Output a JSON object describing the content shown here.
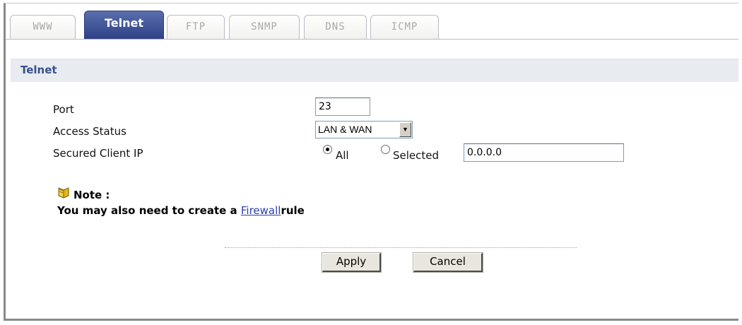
{
  "tabs": [
    {
      "label": "WWW",
      "active": false
    },
    {
      "label": "Telnet",
      "active": true
    },
    {
      "label": "FTP",
      "active": false
    },
    {
      "label": "SNMP",
      "active": false
    },
    {
      "label": "DNS",
      "active": false
    },
    {
      "label": "ICMP",
      "active": false
    }
  ],
  "section": {
    "title": "Telnet"
  },
  "form": {
    "port_label": "Port",
    "port_value": "23",
    "access_status_label": "Access Status",
    "access_status_value": "LAN & WAN",
    "secured_client_ip_label": "Secured Client IP",
    "radio_all_label": "All",
    "radio_selected_label": "Selected",
    "selected_radio": "All",
    "client_ip_value": "0.0.0.0"
  },
  "note": {
    "label": "Note :",
    "text_prefix": "You may also need to create a ",
    "link_text": "Firewall",
    "text_suffix": "rule"
  },
  "buttons": {
    "apply_label": "Apply",
    "cancel_label": "Cancel"
  },
  "colors": {
    "active_tab": "#2e3f86",
    "section_title": "#38518a",
    "section_bg": "#e8ebef",
    "link": "#2d3fa8"
  }
}
